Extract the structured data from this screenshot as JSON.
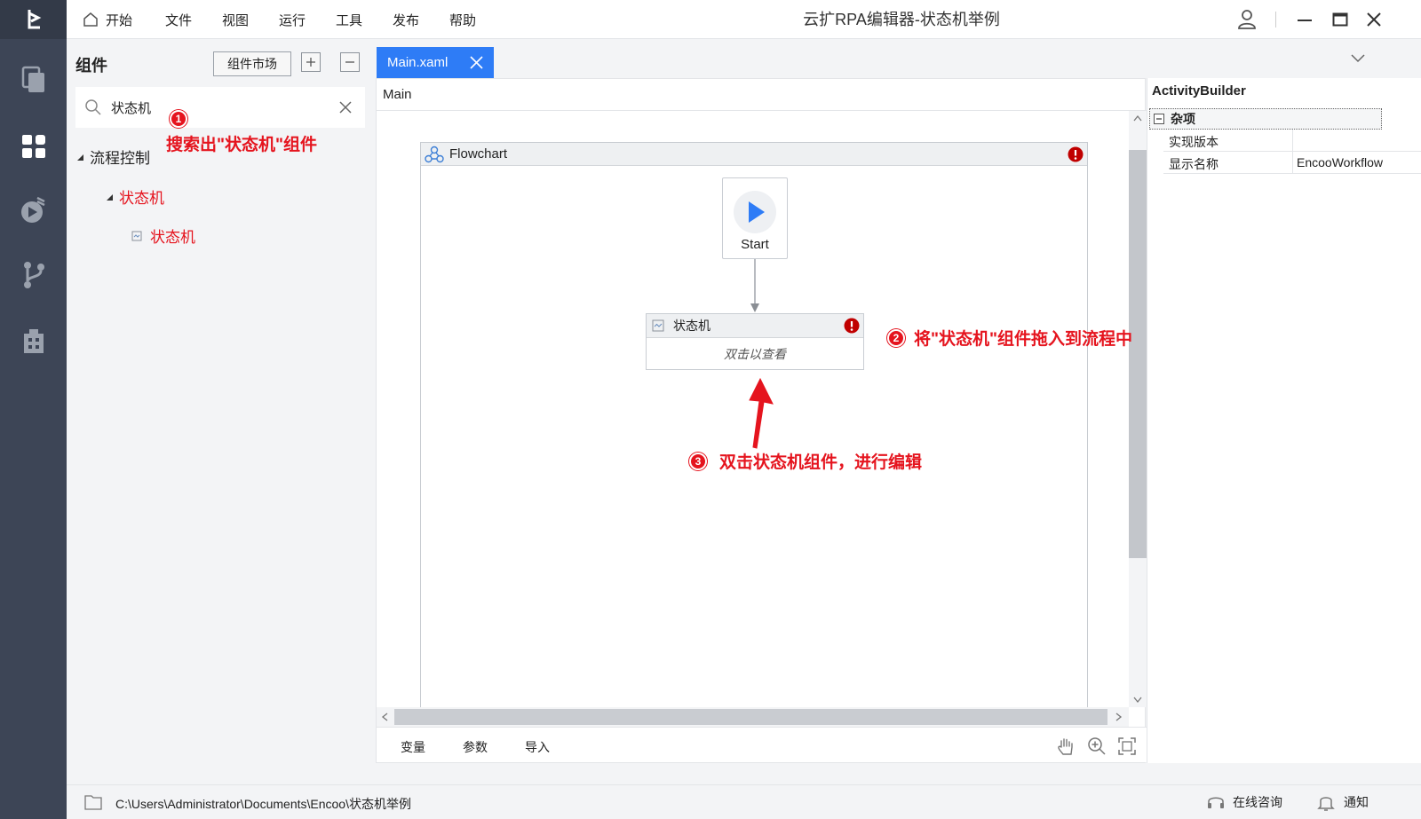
{
  "app": {
    "title": "云扩RPA编辑器-状态机举例",
    "menu": [
      "开始",
      "文件",
      "视图",
      "运行",
      "工具",
      "发布",
      "帮助"
    ]
  },
  "components": {
    "title": "组件",
    "market_label": "组件市场",
    "search_value": "状态机",
    "tree": {
      "category": "流程控制",
      "group": "状态机",
      "item": "状态机"
    }
  },
  "editor": {
    "tab_label": "Main.xaml",
    "breadcrumb": "Main",
    "flowchart_title": "Flowchart",
    "start_label": "Start",
    "state_machine": {
      "title": "状态机",
      "hint": "双击以查看"
    },
    "bottom_tabs": [
      "变量",
      "参数",
      "导入"
    ]
  },
  "properties": {
    "title": "ActivityBuilder",
    "category": "杂项",
    "rows": [
      {
        "key": "实现版本",
        "value": ""
      },
      {
        "key": "显示名称",
        "value": "EncooWorkflow"
      }
    ]
  },
  "status": {
    "path": "C:\\Users\\Administrator\\Documents\\Encoo\\状态机举例",
    "online_label": "在线咨询",
    "notify_label": "通知"
  },
  "annotations": [
    {
      "num": "1",
      "text": "搜索出\"状态机\"组件"
    },
    {
      "num": "2",
      "text": "将\"状态机\"组件拖入到流程中"
    },
    {
      "num": "3",
      "text": "双击状态机组件，进行编辑"
    }
  ],
  "colors": {
    "accent": "#2e7cf6",
    "rail": "#3d4556",
    "annotation": "#e5141e",
    "error": "#c00000"
  }
}
